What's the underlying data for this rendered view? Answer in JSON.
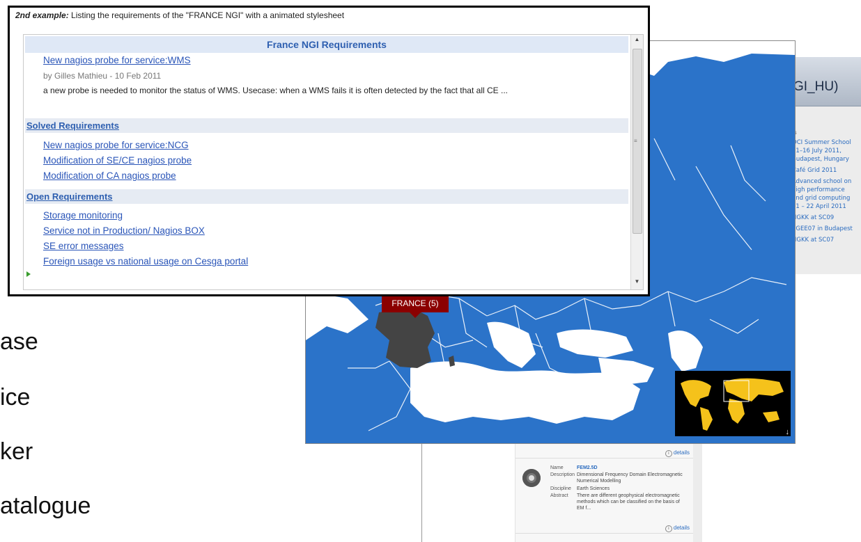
{
  "background_slide": {
    "bullets": [
      "ase",
      "ice",
      "ker",
      "atalogue"
    ]
  },
  "requirements_window": {
    "caption_bold": "2nd example:",
    "caption_rest": " Listing the requirements of the \"FRANCE NGI\" with a animated stylesheet",
    "header": "France NGI Requirements",
    "featured": {
      "title": "New nagios probe for service:WMS",
      "byline": "by Gilles Mathieu - 10 Feb 2011",
      "description": "a new probe is needed to monitor the status of WMS. Usecase: when a WMS fails it is often detected by the fact that all CE ..."
    },
    "solved": {
      "label": "Solved Requirements",
      "items": [
        "New nagios probe for service:NCG",
        "Modification of SE/CE nagios probe",
        "Modification of CA nagios probe"
      ]
    },
    "open": {
      "label": "Open Requirements",
      "items": [
        "Storage monitoring",
        "Service not in Production/ Nagios BOX",
        "SE error messages",
        "Foreign usage vs national usage on Cesga portal"
      ]
    }
  },
  "map_window": {
    "tooltip": "FRANCE (5)",
    "colors": {
      "country": "#2b73c9",
      "selected": "#444444",
      "sea": "#ffffff",
      "minimap_land": "#f5c21b"
    }
  },
  "news_panel": {
    "title": "GI_HU)",
    "section": "rs",
    "items": [
      "OCI Summer School",
      "11–16 July 2011,",
      "Budapest, Hungary",
      "Café Grid 2011",
      "Advanced school on",
      "high performance",
      "and grid computing",
      "11 – 22 April 2011",
      "NGKK at SC09",
      "EGEE07 in Budapest",
      "NGKK at SC07"
    ]
  },
  "catalogue": {
    "details_label": "details",
    "card": {
      "name_key": "Name",
      "name_value": "FEM2.5D",
      "description_key": "Description",
      "description_value": "Dimensional Frequency Domain Electromagnetic Numerical Modelling",
      "discipline_key": "Discipline",
      "discipline_value": "Earth Sciences",
      "abstract_key": "Abstract",
      "abstract_value": "There are different geophysical electromagnetic methods which can be classified on the basis of EM f..."
    }
  }
}
